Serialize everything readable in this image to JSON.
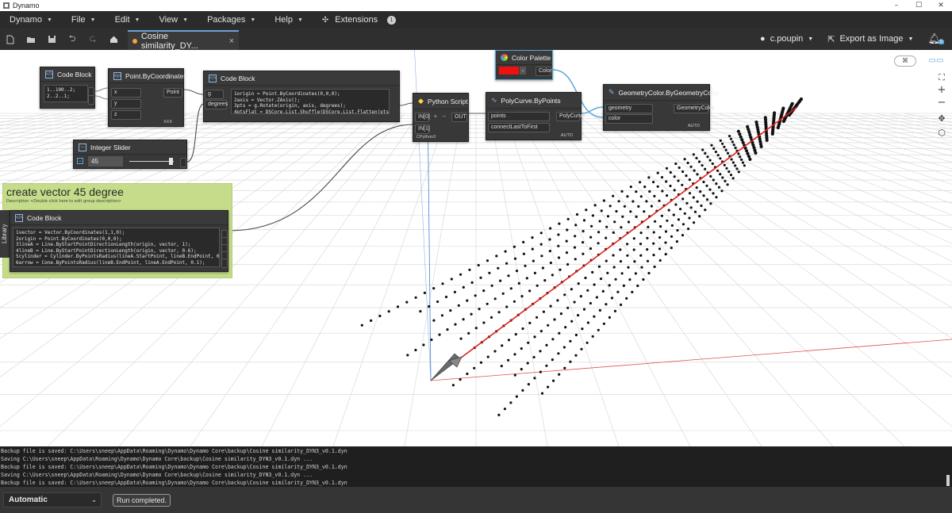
{
  "window": {
    "title": "Dynamo",
    "controls": [
      "–",
      "☐",
      "✕"
    ]
  },
  "menu": {
    "items": [
      "Dynamo",
      "File",
      "Edit",
      "View",
      "Packages",
      "Help"
    ],
    "extensions": "Extensions",
    "extensions_badge": "1"
  },
  "toolbar": {
    "tab_title": "Cosine similarity_DY...",
    "tab_close": "×",
    "user": "c.poupin",
    "export": "Export as Image",
    "notif_count": "5"
  },
  "nodes": {
    "codeblock1": {
      "title": "Code Block",
      "code": "1..100..2;\n2..2..1;"
    },
    "point": {
      "title": "Point.ByCoordinates",
      "inputs": [
        "x",
        "y",
        "z"
      ],
      "output": "Point",
      "lacing": "XXX"
    },
    "codeblock2": {
      "title": "Code Block",
      "inputs": [
        "g",
        "degrees"
      ],
      "code": "1origin = Point.ByCoordinates(0,0,0);\n2axis = Vector.ZAxis();\n3pts = g.Rotate(origin, axis, degrees);\n4ptsFlat = DSCore.List.Shuffle(DSCore.List.Flatten(pts));"
    },
    "slider": {
      "title": "Integer Slider",
      "value": "45"
    },
    "python": {
      "title": "Python Script",
      "inputs": [
        "IN[0]",
        "IN[1]"
      ],
      "output": "OUT",
      "footer": "CPython3"
    },
    "polycurve": {
      "title": "PolyCurve.ByPoints",
      "inputs": [
        "points",
        "connectLastToFirst"
      ],
      "output": "PolyCurve",
      "lacing": "AUTO"
    },
    "palette": {
      "title": "Color Palette",
      "output": "Color",
      "color": "#ee1111"
    },
    "geomcolor": {
      "title": "GeometryColor.ByGeometryColor",
      "inputs": [
        "geometry",
        "color"
      ],
      "output": "GeometryColor",
      "lacing": "AUTO"
    },
    "codeblock3": {
      "title": "Code Block",
      "code": "1vector = Vector.ByCoordinates(1,1,0);\n2origin = Point.ByCoordinates(0,0,0);\n3lineA = Line.ByStartPointDirectionLength(origin, vector, 1);\n4lineB = Line.ByStartPointDirectionLength(origin, vector, 0.6);\n5cylinder = Cylinder.ByPointsRadius(lineA.StartPoint, lineB.EndPoint, 0.05);\n6arrow = Cone.ByPointsRadius(lineB.EndPoint, lineA.EndPoint, 0.1);"
    }
  },
  "group": {
    "title": "create vector 45 degree",
    "description": "Description <Double click here to edit group description>"
  },
  "library": "Library",
  "console": [
    "Backup file is saved: C:\\Users\\sneep\\AppData\\Roaming\\Dynamo\\Dynamo Core\\backup\\Cosine similarity_DYN3_v0.1.dyn",
    "Saving C:\\Users\\sneep\\AppData\\Roaming\\Dynamo\\Dynamo Core\\backup\\Cosine similarity_DYN3_v0.1.dyn ...",
    "Backup file is saved: C:\\Users\\sneep\\AppData\\Roaming\\Dynamo\\Dynamo Core\\backup\\Cosine similarity_DYN3_v0.1.dyn",
    "Saving C:\\Users\\sneep\\AppData\\Roaming\\Dynamo\\Dynamo Core\\backup\\Cosine similarity_DYN3_v0.1.dyn ...",
    "Backup file is saved: C:\\Users\\sneep\\AppData\\Roaming\\Dynamo\\Dynamo Core\\backup\\Cosine similarity_DYN3_v0.1.dyn"
  ],
  "status": {
    "run_mode": "Automatic",
    "run_status": "Run completed."
  },
  "colors": {
    "accent": "#f7a43b",
    "wire": "#5aa8da",
    "red_vector": "#e0201e",
    "group_fill": "#c5dc8a"
  }
}
